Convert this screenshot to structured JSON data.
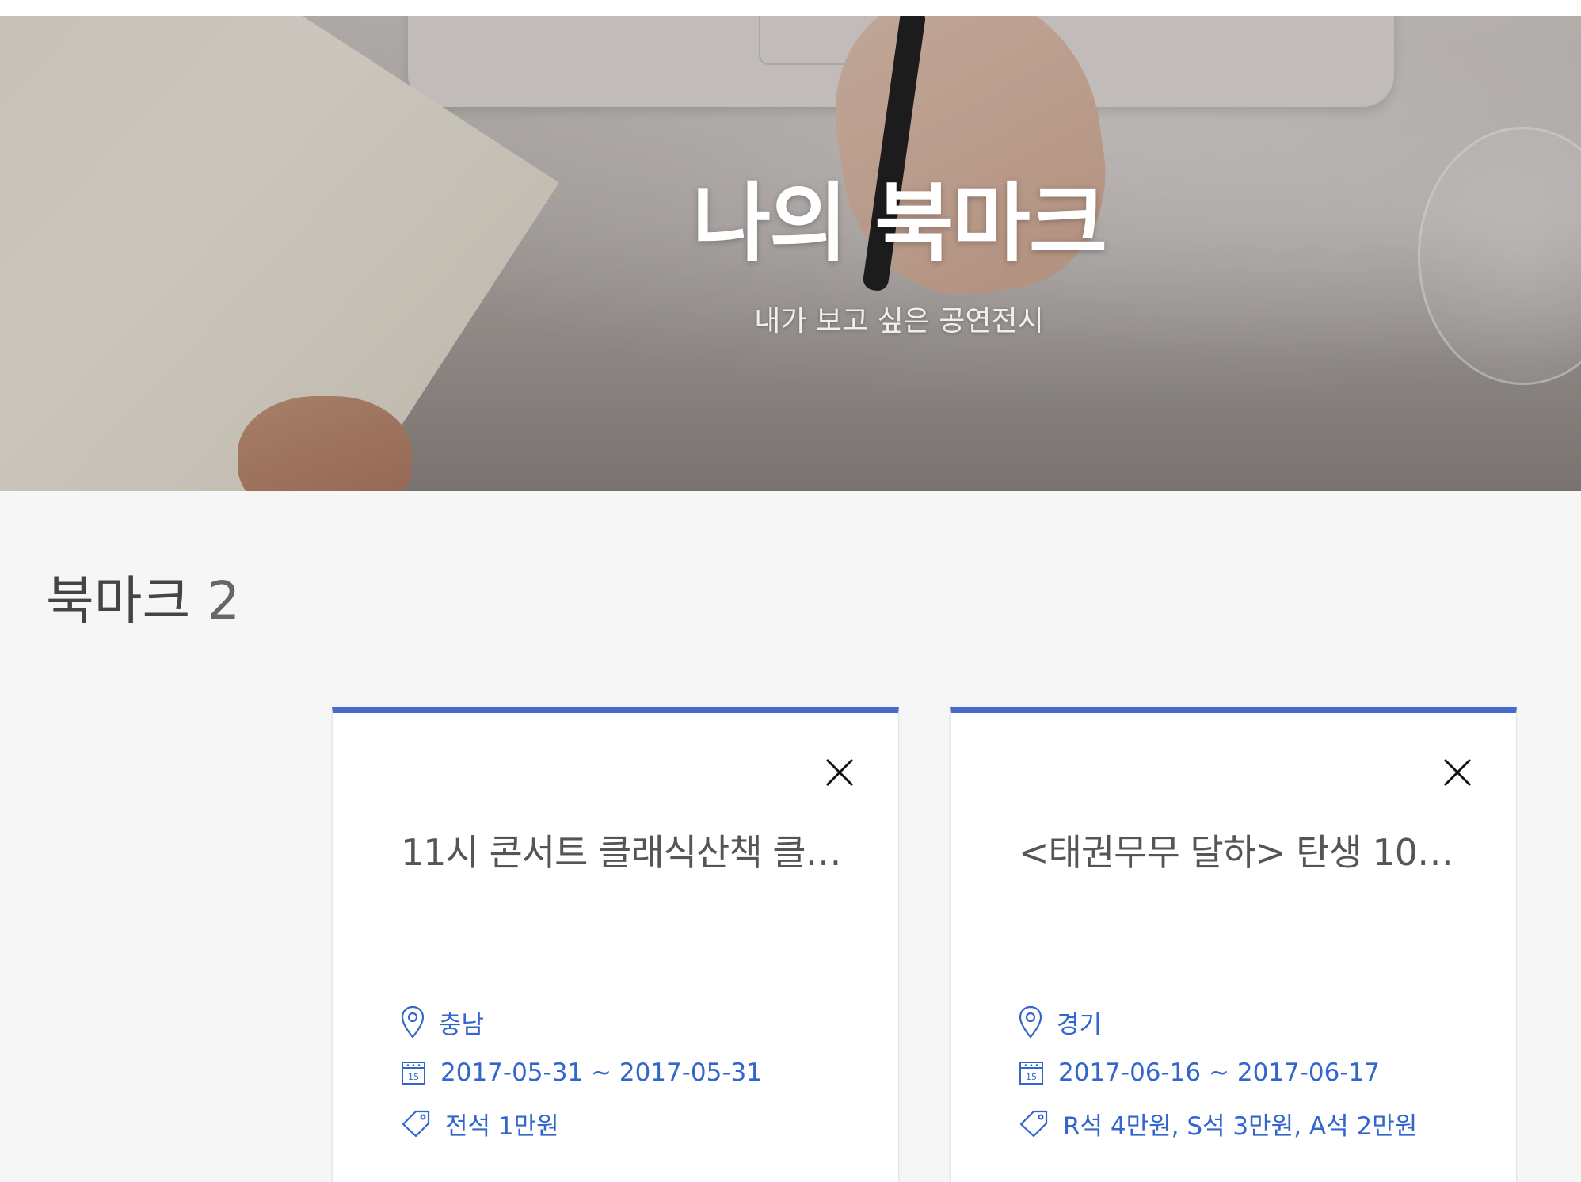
{
  "hero": {
    "title": "나의 북마크",
    "subtitle": "내가 보고 싶은 공연전시"
  },
  "bookmarks": {
    "heading": "북마크",
    "count": "2",
    "cards": [
      {
        "title": "11시 콘서트 클래식산책 클…",
        "location": "충남",
        "dates": "2017-05-31 ~ 2017-05-31",
        "price": "전석 1만원"
      },
      {
        "title": "<태권무무 달하> 탄생 10주…",
        "location": "경기",
        "dates": "2017-06-16 ~ 2017-06-17",
        "price": "R석 4만원, S석 3만원, A석 2만원"
      }
    ]
  },
  "icons": {
    "close": "close-icon",
    "location": "location-pin-icon",
    "calendar": "calendar-icon",
    "price": "price-tag-icon"
  },
  "colors": {
    "accent": "#4a6acb",
    "meta_text": "#3366cc",
    "page_bg": "#f6f6f6"
  }
}
